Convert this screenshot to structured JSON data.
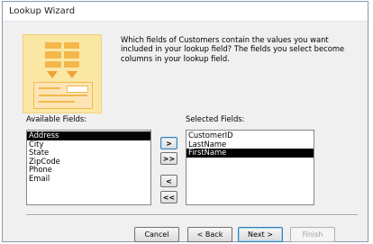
{
  "window": {
    "title": "Lookup Wizard"
  },
  "prompt": "Which fields of Customers contain the values you want included in your lookup field? The fields you select become columns in your lookup field.",
  "available": {
    "label": "Available Fields:",
    "items": [
      "Address",
      "City",
      "State",
      "ZipCode",
      "Phone",
      "Email"
    ],
    "selected_index": 0
  },
  "selected": {
    "label": "Selected Fields:",
    "items": [
      "CustomerID",
      "LastName",
      "FirstName"
    ],
    "selected_index": 2
  },
  "move_buttons": {
    "add": ">",
    "add_all": ">>",
    "remove": "<",
    "remove_all": "<<"
  },
  "footer": {
    "cancel": "Cancel",
    "back": "< Back",
    "next": "Next >",
    "finish": "Finish"
  }
}
